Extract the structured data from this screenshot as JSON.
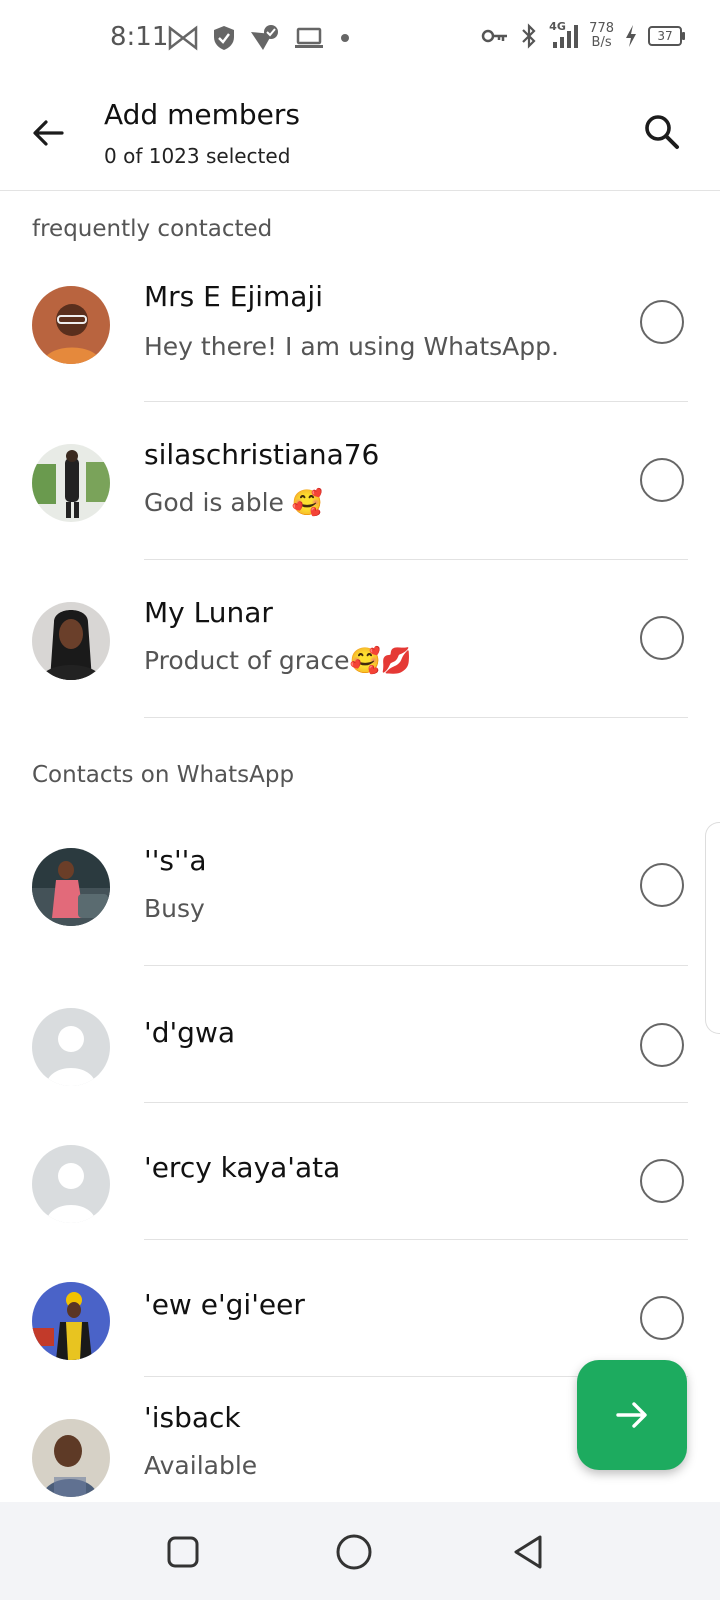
{
  "status_bar": {
    "time": "8:11",
    "network_speed_value": "778",
    "network_speed_unit": "B/s",
    "network_type": "4G",
    "battery_level": "37"
  },
  "header": {
    "title": "Add members",
    "subtitle": "0 of 1023 selected"
  },
  "sections": {
    "frequently_contacted": "frequently contacted",
    "contacts_on_whatsapp": "Contacts on WhatsApp"
  },
  "contacts": [
    {
      "name": "Mrs E Ejimaji",
      "status": "Hey there! I am using WhatsApp."
    },
    {
      "name": "silaschristiana76",
      "status": "God is able 🥰"
    },
    {
      "name": "My Lunar",
      "status": "Product of grace🥰💋"
    },
    {
      "name": "''s''a",
      "status": "Busy"
    },
    {
      "name": "'d'gwa",
      "status": ""
    },
    {
      "name": "'ercy kaya'ata",
      "status": ""
    },
    {
      "name": "'ew e'gi'eer",
      "status": ""
    },
    {
      "name": "'isback",
      "status": "Available"
    }
  ],
  "colors": {
    "accent": "#1dab5f",
    "placeholder_avatar": "#d9dcde"
  }
}
